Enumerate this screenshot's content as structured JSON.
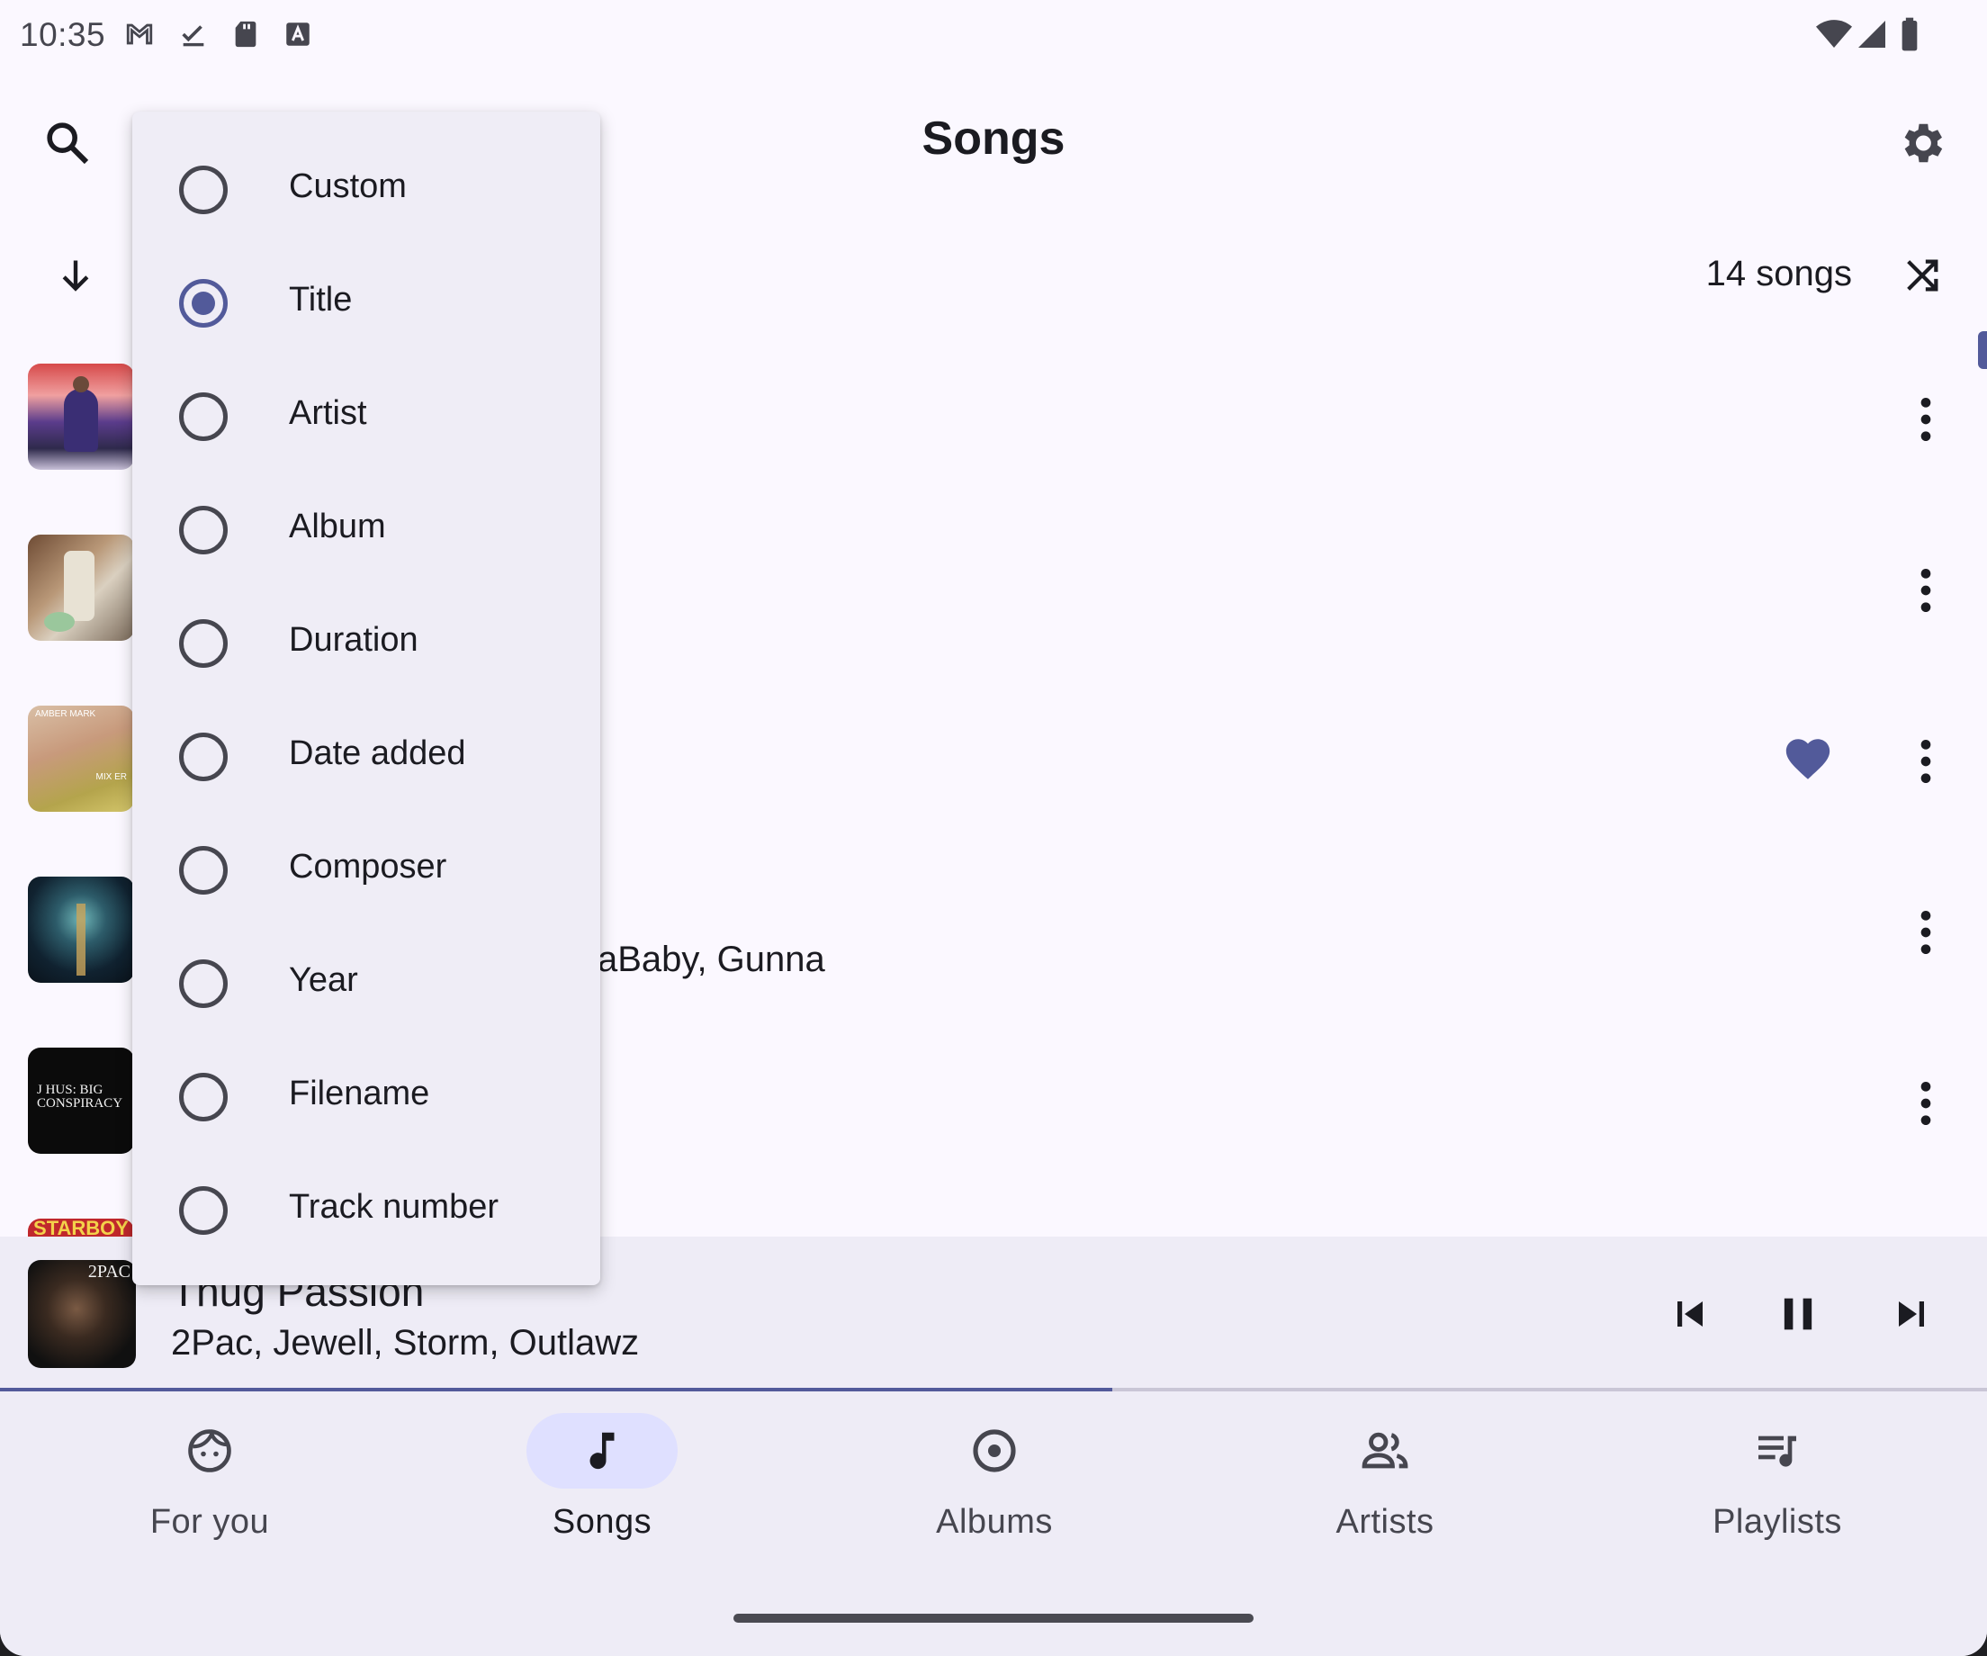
{
  "status_bar": {
    "time": "10:35",
    "left_icons": [
      "gmail-icon",
      "download-done-icon",
      "sd-card-icon",
      "text-a-icon"
    ],
    "right_icons": [
      "wifi-icon",
      "cell-signal-icon",
      "battery-icon"
    ]
  },
  "app_bar": {
    "title": "Songs",
    "left_icon": "search-icon",
    "right_icon": "settings-gear-icon"
  },
  "sort_row": {
    "direction_icon": "arrow-down-icon",
    "count_label": "14 songs",
    "shuffle_icon": "shuffle-icon"
  },
  "sort_menu": {
    "selected": "Title",
    "options": [
      {
        "label": "Custom",
        "checked": false
      },
      {
        "label": "Title",
        "checked": true
      },
      {
        "label": "Artist",
        "checked": false
      },
      {
        "label": "Album",
        "checked": false
      },
      {
        "label": "Duration",
        "checked": false
      },
      {
        "label": "Date added",
        "checked": false
      },
      {
        "label": "Composer",
        "checked": false
      },
      {
        "label": "Year",
        "checked": false
      },
      {
        "label": "Filename",
        "checked": false
      },
      {
        "label": "Track number",
        "checked": false
      }
    ]
  },
  "songs": {
    "visible_partial_text": "aBaby, Gunna",
    "favorited_row": 3,
    "art_text": {
      "row3": "AMBER MARK",
      "row3b": "MIX ER",
      "row5": "J HUS: BIG CONSPIRACY",
      "row6": "STARBOY"
    }
  },
  "now_playing": {
    "title": "Thug Passion",
    "artist": "2Pac, Jewell, Storm, Outlawz",
    "art_text": "2PAC",
    "progress_fraction": 0.56,
    "controls": [
      "skip-previous-icon",
      "pause-icon",
      "skip-next-icon"
    ]
  },
  "bottom_nav": {
    "active": "Songs",
    "items": [
      {
        "label": "For you",
        "icon": "face-icon"
      },
      {
        "label": "Songs",
        "icon": "music-note-icon"
      },
      {
        "label": "Albums",
        "icon": "album-icon"
      },
      {
        "label": "Artists",
        "icon": "people-icon"
      },
      {
        "label": "Playlists",
        "icon": "queue-music-icon"
      }
    ]
  },
  "colors": {
    "accent": "#525a9a",
    "surface": "#fbf8ff",
    "surface_container": "#eeecf6",
    "active_pill": "#dfe0ff"
  }
}
